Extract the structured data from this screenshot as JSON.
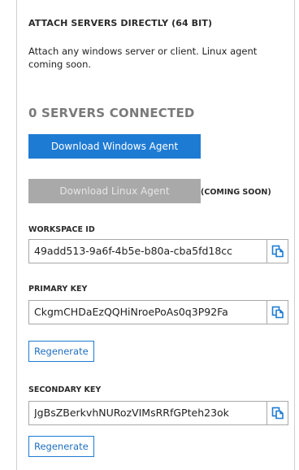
{
  "section": {
    "title": "ATTACH SERVERS DIRECTLY (64 BIT)",
    "description": "Attach any windows server or client. Linux agent coming soon."
  },
  "status": {
    "servers_connected": "0 SERVERS CONNECTED"
  },
  "agents": {
    "windows_button": "Download Windows Agent",
    "linux_button": "Download Linux Agent",
    "linux_note": "(COMING SOON)"
  },
  "workspace": {
    "label": "WORKSPACE ID",
    "value": "49add513-9a6f-4b5e-b80a-cba5fd18cc"
  },
  "primary": {
    "label": "PRIMARY KEY",
    "value": "CkgmCHDaEzQQHiNroePoAs0q3P92Fa",
    "regenerate": "Regenerate"
  },
  "secondary": {
    "label": "SECONDARY KEY",
    "value": "JgBsZBerkvhNURozVIMsRRfGPteh23ok",
    "regenerate": "Regenerate"
  },
  "colors": {
    "accent": "#1e7bd3",
    "disabled": "#a9a9a9",
    "copy_icon": "#1e7bd3"
  },
  "icons": {
    "copy": "copy-icon"
  }
}
